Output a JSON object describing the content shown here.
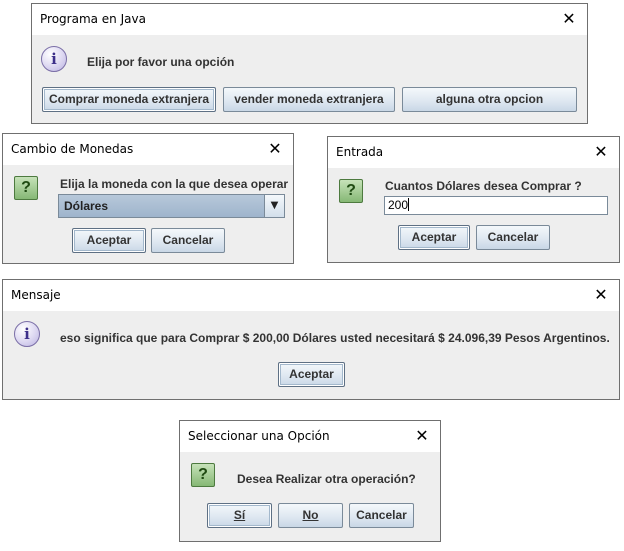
{
  "dialog_main": {
    "title": "Programa en Java",
    "message": "Elija por favor una opción",
    "icon": "info-icon",
    "buttons": [
      "Comprar moneda extranjera",
      "vender moneda extranjera",
      "alguna otra opcion"
    ]
  },
  "dialog_cambio": {
    "title": "Cambio de Monedas",
    "message": "Elija la moneda con la que desea operar",
    "icon": "question-icon",
    "select_value": "Dólares",
    "accept_label": "Aceptar",
    "cancel_label": "Cancelar"
  },
  "dialog_entrada": {
    "title": "Entrada",
    "message": "Cuantos Dólares desea Comprar ?",
    "icon": "question-icon",
    "input_value": "200",
    "accept_label": "Aceptar",
    "cancel_label": "Cancelar"
  },
  "dialog_mensaje": {
    "title": "Mensaje",
    "message": "eso significa que para Comprar $ 200,00 Dólares usted necesitará $ 24.096,39 Pesos Argentinos.",
    "icon": "info-icon",
    "accept_label": "Aceptar"
  },
  "dialog_seleccionar": {
    "title": "Seleccionar una Opción",
    "message": "Desea Realizar otra operación?",
    "icon": "question-icon",
    "yes_label": "Sí",
    "no_label": "No",
    "cancel_label": "Cancelar"
  },
  "common": {
    "close_glyph": "✕",
    "info_glyph": "i",
    "question_glyph": "?",
    "dropdown_glyph": "▼"
  }
}
